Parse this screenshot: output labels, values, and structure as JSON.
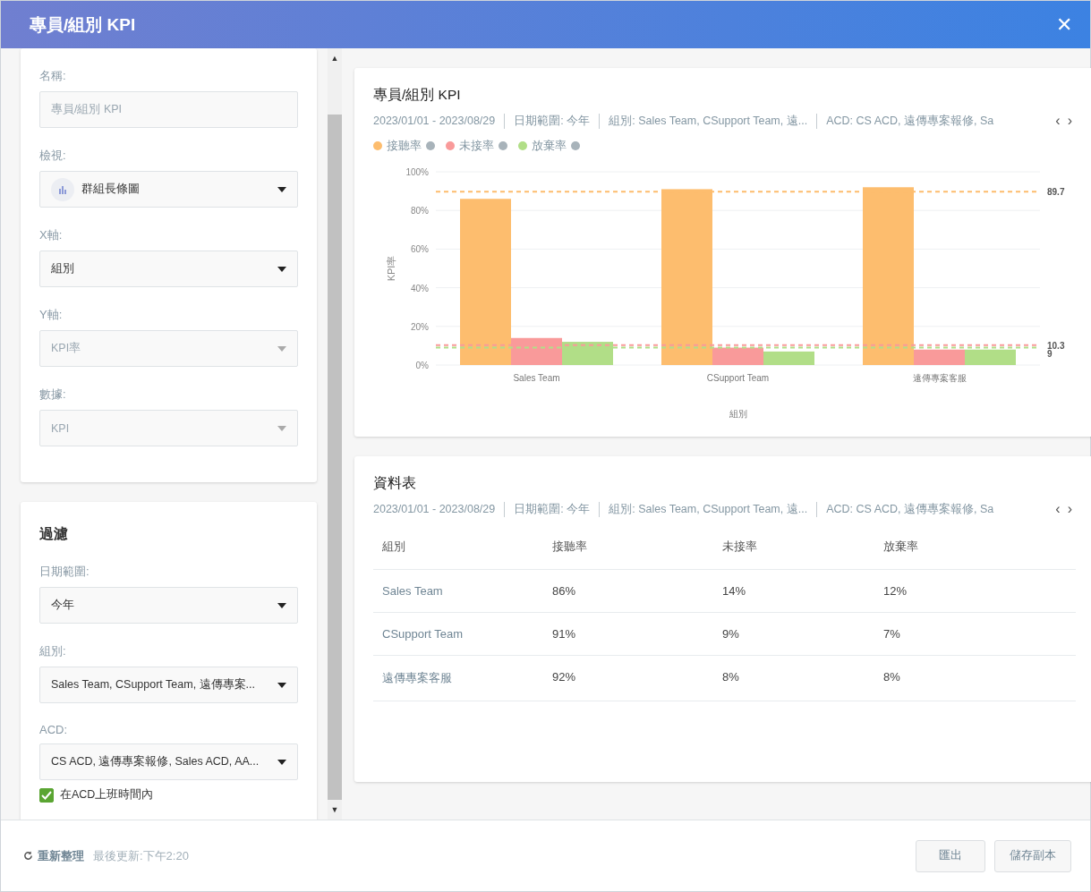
{
  "window": {
    "title": "專員/組別 KPI",
    "close": "✕",
    "scroll_up": "▲",
    "scroll_down": "▼"
  },
  "settings": {
    "fields": [
      {
        "label": "名稱:",
        "kind": "input",
        "value": "專員/組別 KPI",
        "disabled": true
      },
      {
        "label": "檢視:",
        "kind": "select",
        "value": "群組長條圖",
        "disabled": false,
        "icon": true
      },
      {
        "label": "X軸:",
        "kind": "select",
        "value": "組別",
        "disabled": false
      },
      {
        "label": "Y軸:",
        "kind": "select",
        "value": "KPI率",
        "disabled": true
      },
      {
        "label": "數據:",
        "kind": "select",
        "value": "KPI",
        "disabled": true
      }
    ]
  },
  "filter": {
    "title": "過濾",
    "fields": [
      {
        "label": "日期範圍:",
        "kind": "select",
        "value": "今年",
        "disabled": false
      },
      {
        "label": "組別:",
        "kind": "select",
        "value": "Sales Team, CSupport Team, 遠傳專案...",
        "disabled": false
      },
      {
        "label": "ACD:",
        "kind": "select",
        "value": "CS ACD, 遠傳專案報修, Sales ACD, AA...",
        "disabled": false
      }
    ],
    "checkbox": {
      "label": "在ACD上班時間內",
      "checked": true
    }
  },
  "chart_card": {
    "title": "專員/組別 KPI",
    "filters": [
      "2023/01/01 - 2023/08/29",
      "日期範圍: 今年",
      "組別: Sales Team, CSupport Team, 遠...",
      "ACD: CS ACD, 遠傳專案報修, Sa"
    ],
    "prev": "‹",
    "next": "›",
    "chart_data": {
      "type": "bar",
      "xlabel": "組別",
      "ylabel": "KPI率",
      "categories": [
        "Sales Team",
        "CSupport Team",
        "遠傳專案客服"
      ],
      "series": [
        {
          "name": "接聽率",
          "color": "#fdbd6e",
          "values": [
            86,
            91,
            92
          ]
        },
        {
          "name": "未接率",
          "color": "#f99a9a",
          "values": [
            14,
            9,
            8
          ]
        },
        {
          "name": "放棄率",
          "color": "#b1de87",
          "values": [
            12,
            7,
            8
          ]
        }
      ],
      "ylim": [
        0,
        100
      ],
      "yticks": [
        {
          "value": 0,
          "label": "0%"
        },
        {
          "value": 20,
          "label": "20%"
        },
        {
          "value": 40,
          "label": "40%"
        },
        {
          "value": 60,
          "label": "60%"
        },
        {
          "value": 80,
          "label": "80%"
        },
        {
          "value": 100,
          "label": "100%"
        }
      ],
      "grid": true,
      "ref_lines": [
        {
          "axis": "y",
          "value": 89.7,
          "label": "89.7",
          "color": "#fdbd6e"
        },
        {
          "axis": "y",
          "value": 10.3,
          "label": "10.3",
          "color": "#f99a9a"
        },
        {
          "axis": "y",
          "value": 9,
          "label": "9",
          "color": "#b1de87"
        }
      ]
    }
  },
  "table_card": {
    "title": "資料表",
    "filters": [
      "2023/01/01 - 2023/08/29",
      "日期範圍: 今年",
      "組別: Sales Team, CSupport Team, 遠...",
      "ACD: CS ACD, 遠傳專案報修, Sa"
    ],
    "prev": "‹",
    "next": "›",
    "columns": [
      "組別",
      "接聽率",
      "未接率",
      "放棄率"
    ],
    "rows": [
      [
        "Sales Team",
        "86%",
        "14%",
        "12%"
      ],
      [
        "CSupport Team",
        "91%",
        "9%",
        "7%"
      ],
      [
        "遠傳專案客服",
        "92%",
        "8%",
        "8%"
      ]
    ]
  },
  "footer": {
    "refresh": "重新整理",
    "updated": "最後更新:下午2:20",
    "buttons": [
      "匯出",
      "儲存副本"
    ]
  }
}
